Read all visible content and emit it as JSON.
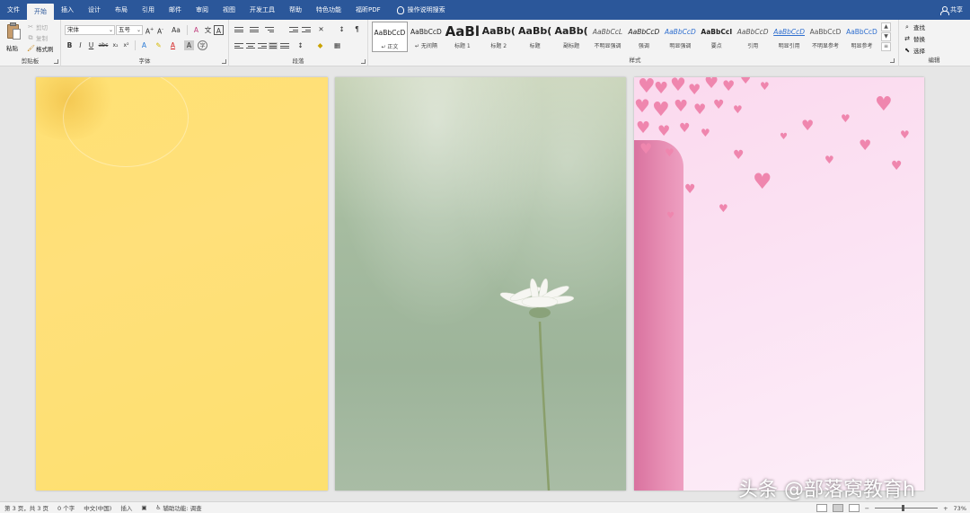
{
  "tabs": [
    {
      "label": "文件"
    },
    {
      "label": "开始",
      "active": true
    },
    {
      "label": "插入"
    },
    {
      "label": "设计"
    },
    {
      "label": "布局"
    },
    {
      "label": "引用"
    },
    {
      "label": "邮件"
    },
    {
      "label": "审阅"
    },
    {
      "label": "视图"
    },
    {
      "label": "开发工具"
    },
    {
      "label": "帮助"
    },
    {
      "label": "特色功能"
    },
    {
      "label": "福昕PDF"
    }
  ],
  "tell_me": "操作说明搜索",
  "share_label": "共享",
  "clipboard": {
    "paste_label": "粘贴",
    "cut_label": "剪切",
    "copy_label": "复制",
    "format_painter_label": "格式刷",
    "group_label": "剪贴板"
  },
  "font": {
    "name_value": "宋体",
    "size_value": "五号",
    "group_label": "字体"
  },
  "paragraph": {
    "group_label": "段落"
  },
  "styles": {
    "group_label": "样式",
    "items": [
      {
        "sample": "AaBbCcD",
        "name": "↵ 正文",
        "selected": true
      },
      {
        "sample": "AaBbCcD",
        "name": "↵ 无间隔"
      },
      {
        "sample": "AaBl",
        "name": "标题 1"
      },
      {
        "sample": "AaBb(",
        "name": "标题 2"
      },
      {
        "sample": "AaBb(",
        "name": "标题"
      },
      {
        "sample": "AaBb(",
        "name": "副标题"
      },
      {
        "sample": "AaBbCcL",
        "name": "不明显强调"
      },
      {
        "sample": "AaBbCcD",
        "name": "强调"
      },
      {
        "sample": "AaBbCcD",
        "name": "明显强调"
      },
      {
        "sample": "AaBbCcI",
        "name": "要点"
      },
      {
        "sample": "AaBbCcD",
        "name": "引用"
      },
      {
        "sample": "AaBbCcD",
        "name": "明显引用"
      },
      {
        "sample": "AaBbCcD",
        "name": "不明显参考"
      },
      {
        "sample": "AaBbCcD",
        "name": "明显参考"
      }
    ]
  },
  "editing": {
    "find_label": "查找",
    "replace_label": "替换",
    "select_label": "选择",
    "group_label": "编辑"
  },
  "watermark": "头条 @部落窝教育h",
  "status": {
    "page": "第 3 页，共 3 页",
    "words": "0 个字",
    "language": "中文(中国)",
    "insert_mode": "插入",
    "accessibility": "辅助功能: 调查",
    "zoom": "73%"
  },
  "colors": {
    "title_bar": "#2b579a",
    "ribbon": "#f3f3f3",
    "doc_background": "#e6e6e6",
    "page1": "#ffe17a",
    "page2": "#a6bca0",
    "page3": "#fbe0f2"
  }
}
